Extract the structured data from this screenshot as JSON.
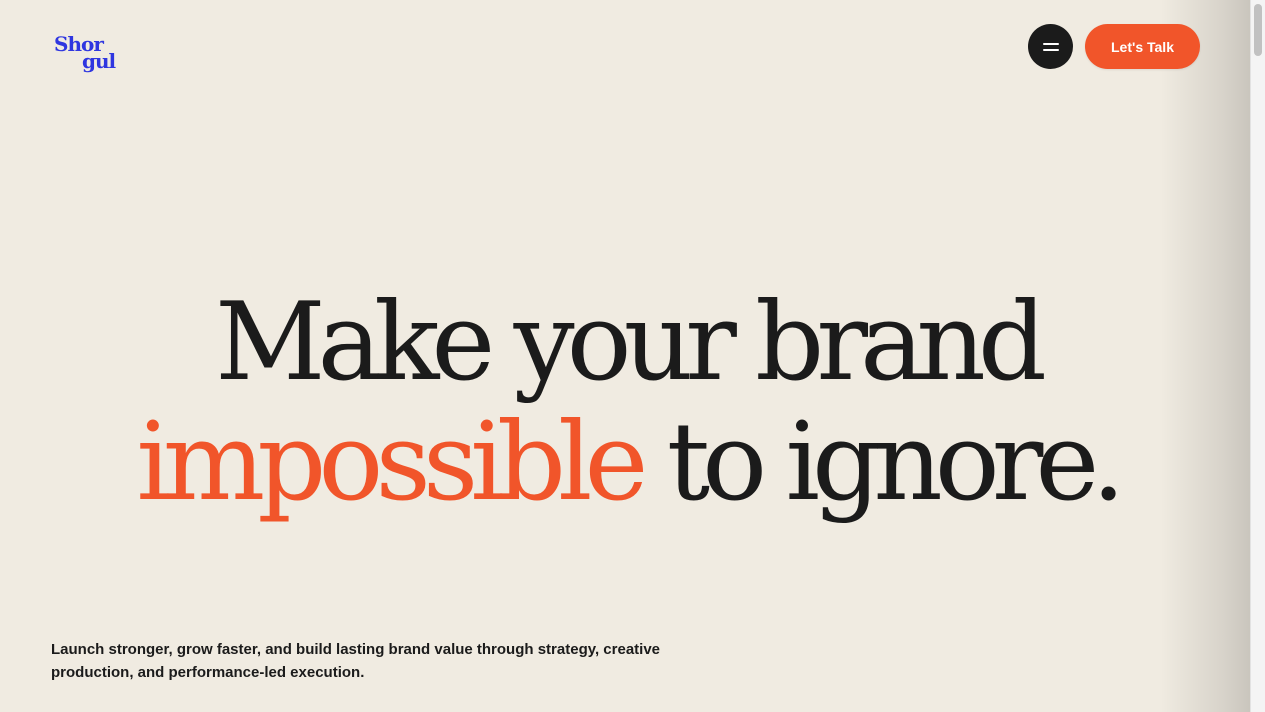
{
  "header": {
    "logo": {
      "line1": "Shor",
      "line2": "gul",
      "color": "#2f36e0"
    },
    "menu_button": {
      "icon": "menu-icon"
    },
    "cta_label": "Let's Talk"
  },
  "hero": {
    "line1": "Make your brand",
    "line2_accent": "impossible",
    "line2_rest": " to ignore."
  },
  "tagline": {
    "line1": "Launch stronger, grow faster, and build lasting brand value through strategy, creative",
    "line2": "production, and performance-led execution."
  },
  "colors": {
    "background": "#f0ebe1",
    "text": "#1b1b1b",
    "accent": "#f1552a",
    "brand": "#2f36e0"
  }
}
